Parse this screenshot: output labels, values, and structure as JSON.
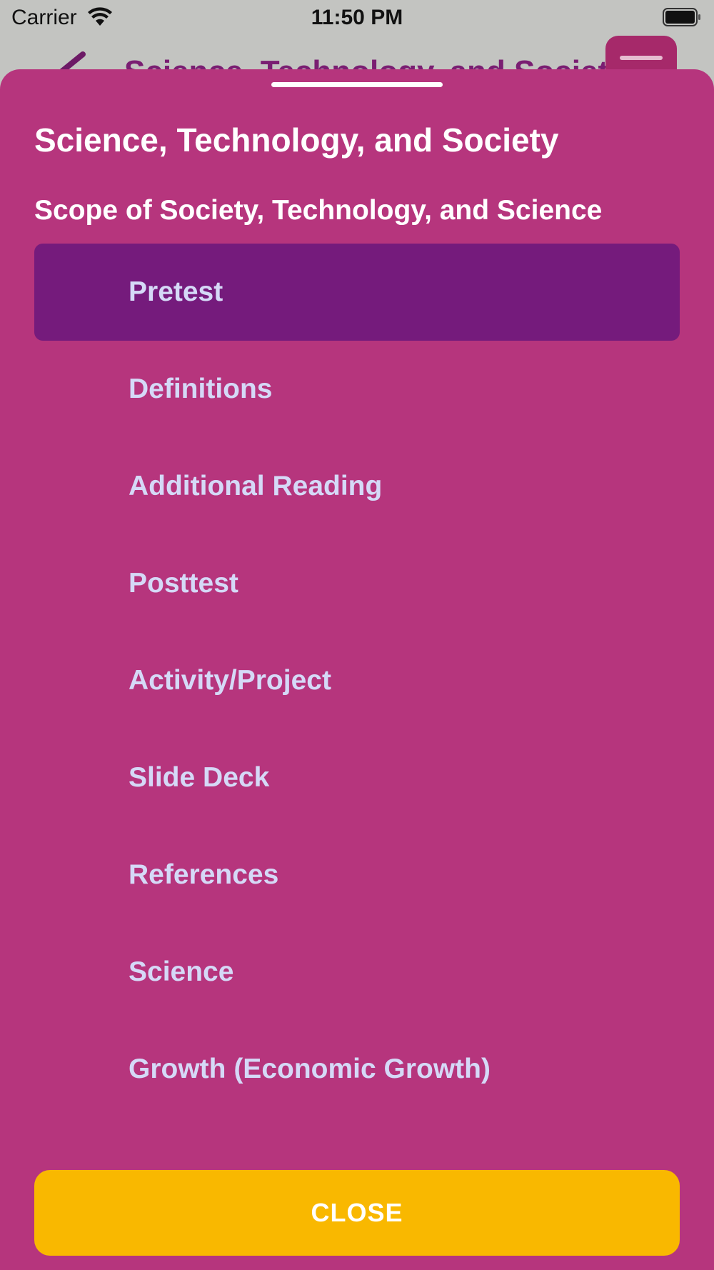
{
  "status_bar": {
    "carrier": "Carrier",
    "time": "11:50 PM",
    "wifi_icon": "wifi-icon",
    "battery_icon": "battery-full-icon"
  },
  "background_page": {
    "title": "Science, Technology, and Society",
    "back_icon": "chevron-left-icon",
    "menu_icon": "menu-icon",
    "accent_color": "#a6296a"
  },
  "sheet": {
    "title": "Science, Technology, and Society",
    "subtitle": "Scope of Society, Technology, and Science",
    "background_color": "#b6357d",
    "selected_color": "#751b7c",
    "items": [
      {
        "label": "Pretest",
        "selected": true
      },
      {
        "label": "Definitions",
        "selected": false
      },
      {
        "label": "Additional Reading",
        "selected": false
      },
      {
        "label": "Posttest",
        "selected": false
      },
      {
        "label": "Activity/Project",
        "selected": false
      },
      {
        "label": "Slide Deck",
        "selected": false
      },
      {
        "label": "References",
        "selected": false
      },
      {
        "label": "Science",
        "selected": false
      },
      {
        "label": "Growth (Economic Growth)",
        "selected": false
      }
    ],
    "close_label": "CLOSE",
    "close_color": "#f9b800"
  }
}
